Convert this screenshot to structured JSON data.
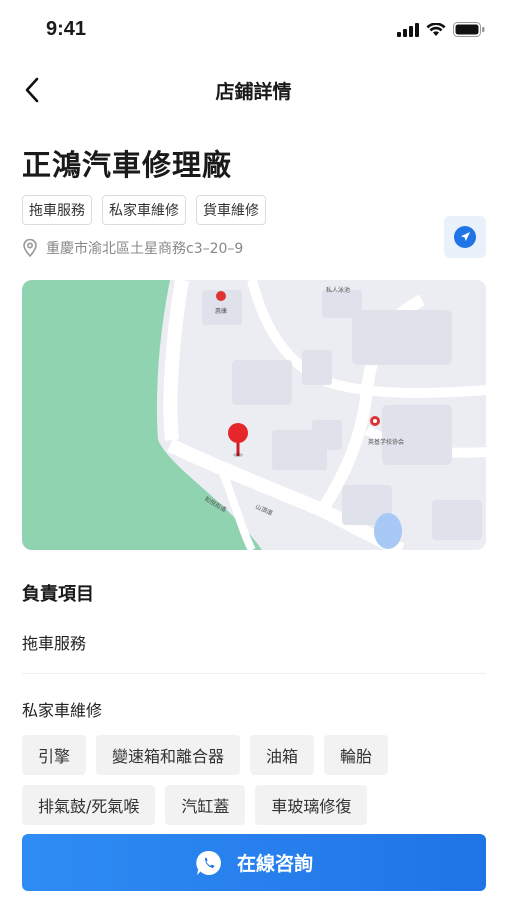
{
  "status": {
    "time": "9:41"
  },
  "nav": {
    "title": "店鋪詳情"
  },
  "shop": {
    "name": "正鴻汽車修理廠",
    "tags": [
      "拖車服務",
      "私家車維修",
      "貨車維修"
    ],
    "address": "重慶市渝北區土星商務c3–20–9"
  },
  "map": {
    "labels": {
      "poi_top": "惠康",
      "poi_top_right": "私人泳池",
      "poi_right": "英基学校协会",
      "road_left": "和悅街道",
      "road_bottom": "山頂道"
    }
  },
  "responsibilities": {
    "title": "負責項目",
    "main_service": "拖車服務",
    "sub_title": "私家車維修",
    "items": [
      "引擎",
      "變速箱和離合器",
      "油箱",
      "輪胎",
      "排氣鼓/死氣喉",
      "汽缸蓋",
      "車玻璃修復"
    ]
  },
  "cta": {
    "label": "在線咨詢"
  },
  "colors": {
    "accent": "#1f74e6",
    "pin": "#e5262b",
    "park": "#8fd3b0",
    "map_bg": "#ebedf3"
  }
}
